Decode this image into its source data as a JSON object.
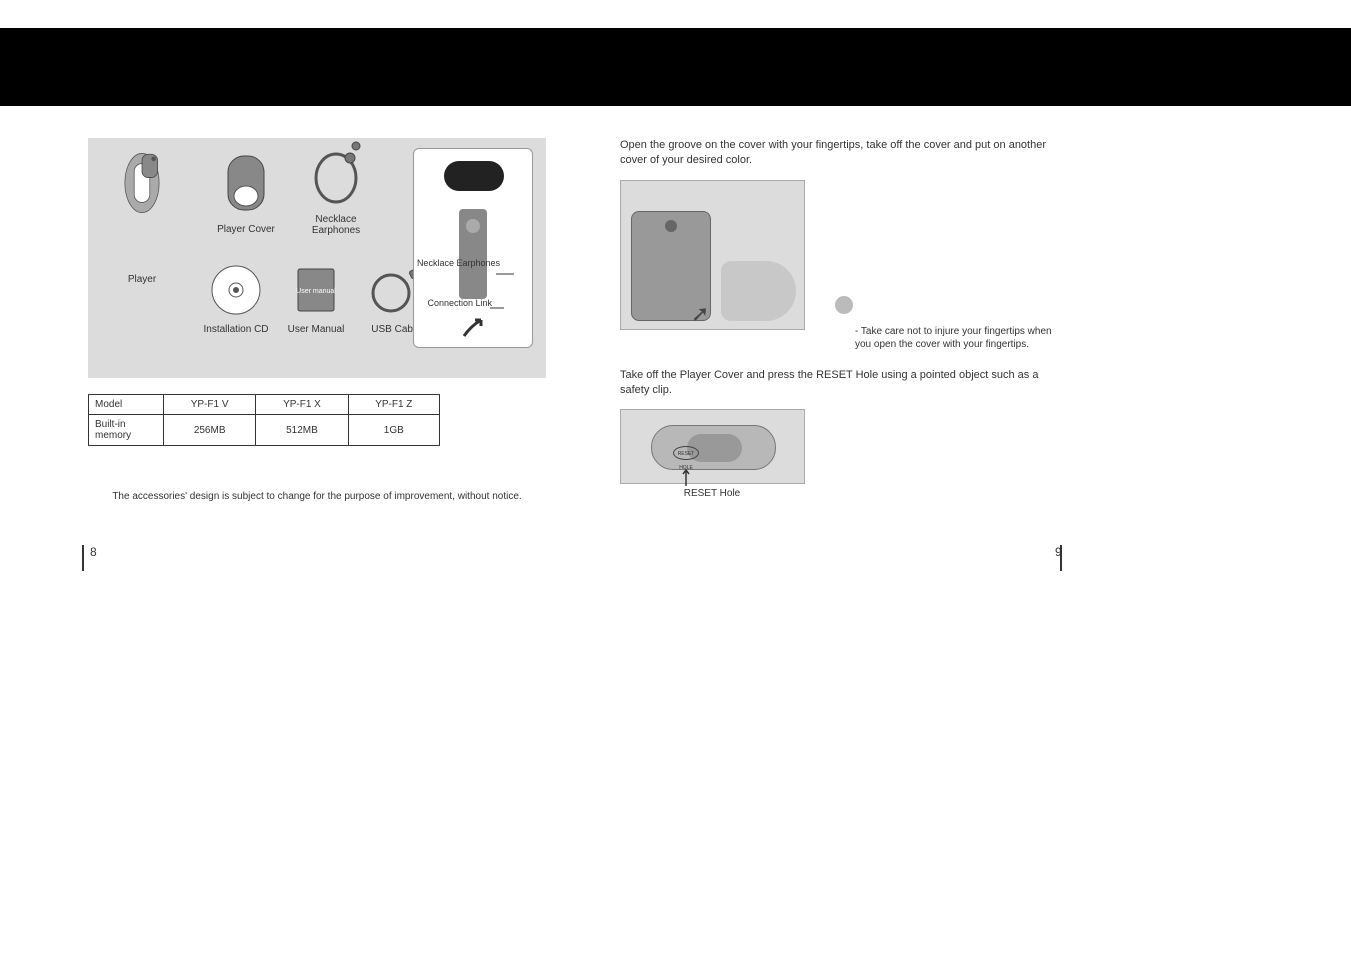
{
  "accessories": {
    "player": "Player",
    "player_cover": "Player Cover",
    "necklace_earphones": "Necklace Earphones",
    "installation_cd": "Installation CD",
    "user_manual": "User Manual",
    "usb_cable": "USB Cable",
    "necklace_earphones_callout": "Necklace Earphones",
    "connection_link": "Connection Link"
  },
  "table": {
    "row1_label": "Model",
    "row2_label": "Built-in memory",
    "models": [
      "YP-F1 V",
      "YP-F1 X",
      "YP-F1 Z"
    ],
    "memory": [
      "256MB",
      "512MB",
      "1GB"
    ]
  },
  "disclaimer": "The accessories' design is subject to change for the purpose of improvement, without notice.",
  "right": {
    "instr1": "Open the groove on the cover with your fingertips, take off the cover and put on another cover of your desired color.",
    "note": "- Take care not to injure your fingertips when you open the cover with your fingertips.",
    "instr2": "Take off the Player Cover and press the RESET Hole using a pointed object such as a safety clip.",
    "reset_hole": "RESET Hole",
    "reset_tiny": "RESET HOLE"
  },
  "pages": {
    "left": "8",
    "right": "9"
  }
}
